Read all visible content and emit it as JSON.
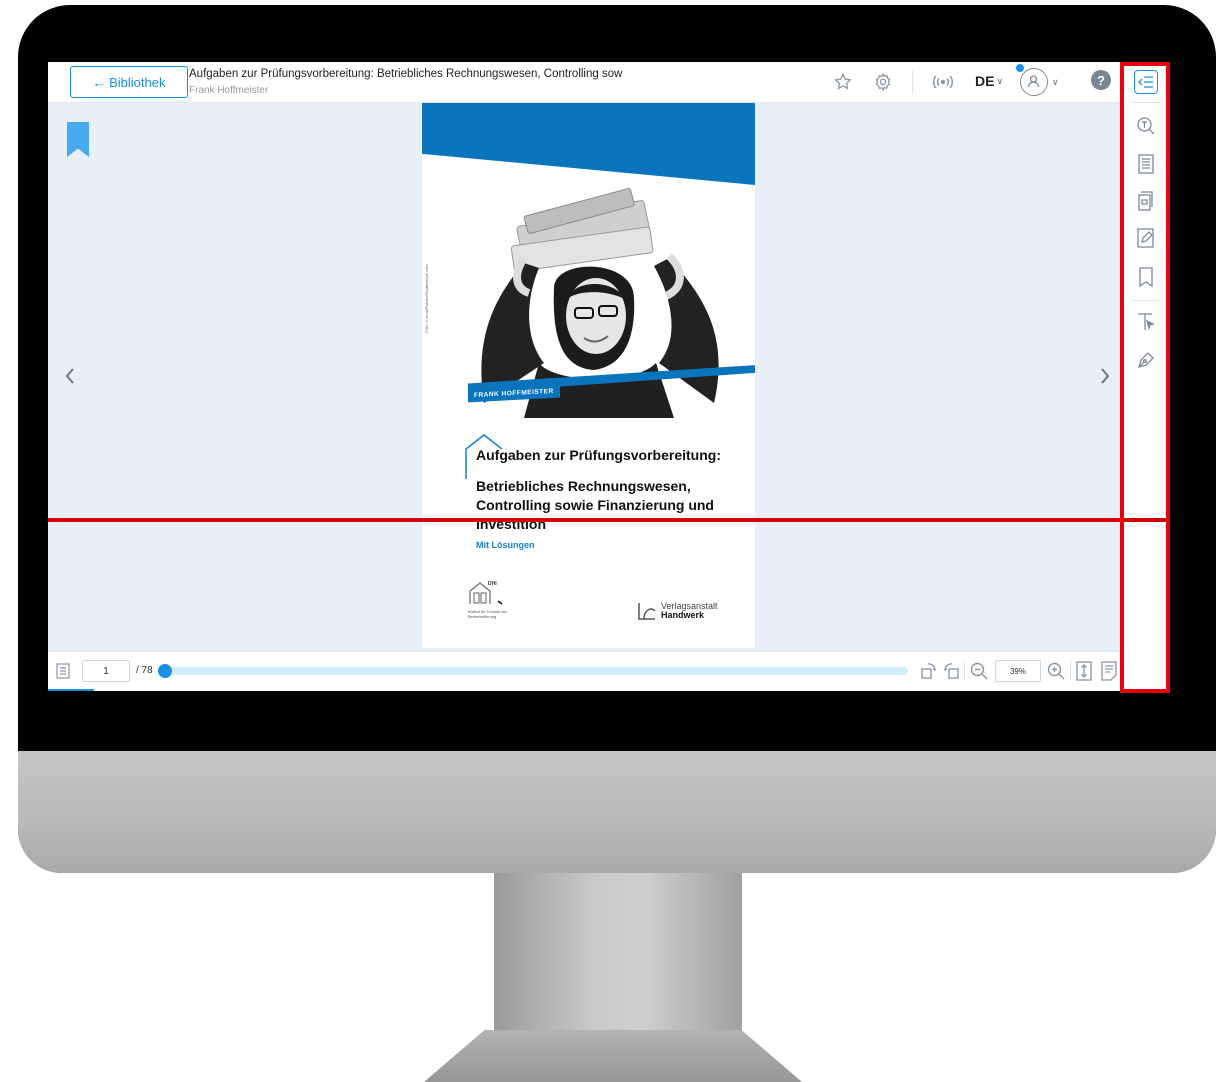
{
  "header": {
    "back_label": "← Bibliothek",
    "title": "Aufgaben zur Prüfungsvorbereitung: Betriebliches Rechnungswesen, Controlling sow",
    "author": "Frank Hoffmeister",
    "language": "DE",
    "help": "?"
  },
  "cover": {
    "author_tag": "FRANK HOFFMEISTER",
    "title_line1": "Aufgaben zur Prüfungsvorbereitung:",
    "title_line2": "Betriebliches Rechnungswesen, Controlling sowie Finanzierung und Investition",
    "subtitle": "Mit Lösungen",
    "photo_credit": "Foto: © scusi/Fotolia/Shutterstock.com",
    "logo_left_label": "DHI",
    "logo_left_text": "Institut für Technik der Betriebsführung",
    "logo_right_line1": "Verlagsanstalt",
    "logo_right_line2": "Handwerk"
  },
  "footer": {
    "current_page": "1",
    "total_pages": "/ 78",
    "zoom": "39%",
    "progress": 0.0
  },
  "colors": {
    "accent": "#1a8fe3",
    "cover_blue": "#0a74bd",
    "highlight": "#e8000d"
  },
  "icons": {
    "sidebar": [
      "collapse-panel-icon",
      "text-search-icon",
      "table-of-contents-icon",
      "page-thumbnails-icon",
      "notes-icon",
      "bookmark-outline-icon",
      "text-select-icon",
      "pen-icon"
    ],
    "topbar": [
      "star-icon",
      "settings-icon",
      "broadcast-icon",
      "user-icon",
      "help-icon"
    ]
  }
}
